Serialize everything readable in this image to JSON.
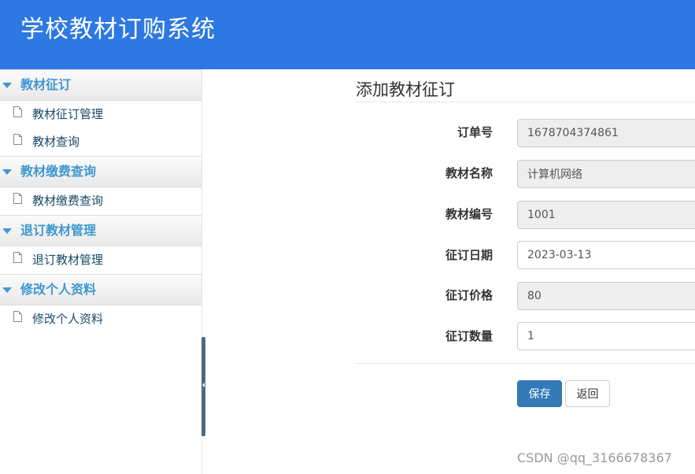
{
  "header": {
    "title": "学校教材订购系统"
  },
  "sidebar": {
    "groups": [
      {
        "title": "教材征订",
        "items": [
          "教材征订管理",
          "教材查询"
        ]
      },
      {
        "title": "教材缴费查询",
        "items": [
          "教材缴费查询"
        ]
      },
      {
        "title": "退订教材管理",
        "items": [
          "退订教材管理"
        ]
      },
      {
        "title": "修改个人资料",
        "items": [
          "修改个人资料"
        ]
      }
    ]
  },
  "main": {
    "title": "添加教材征订",
    "fields": [
      {
        "label": "订单号",
        "value": "1678704374861",
        "readonly": true
      },
      {
        "label": "教材名称",
        "value": "计算机网络",
        "readonly": true
      },
      {
        "label": "教材编号",
        "value": "1001",
        "readonly": true
      },
      {
        "label": "征订日期",
        "value": "2023-03-13",
        "readonly": false
      },
      {
        "label": "征订价格",
        "value": "80",
        "readonly": true
      },
      {
        "label": "征订数量",
        "value": "1",
        "readonly": false
      }
    ],
    "buttons": {
      "save": "保存",
      "back": "返回"
    }
  },
  "watermark": "CSDN @qq_3166678367",
  "colors": {
    "header": "#2d78e3",
    "accent": "#3f97cf",
    "primary_button": "#337ab7"
  }
}
